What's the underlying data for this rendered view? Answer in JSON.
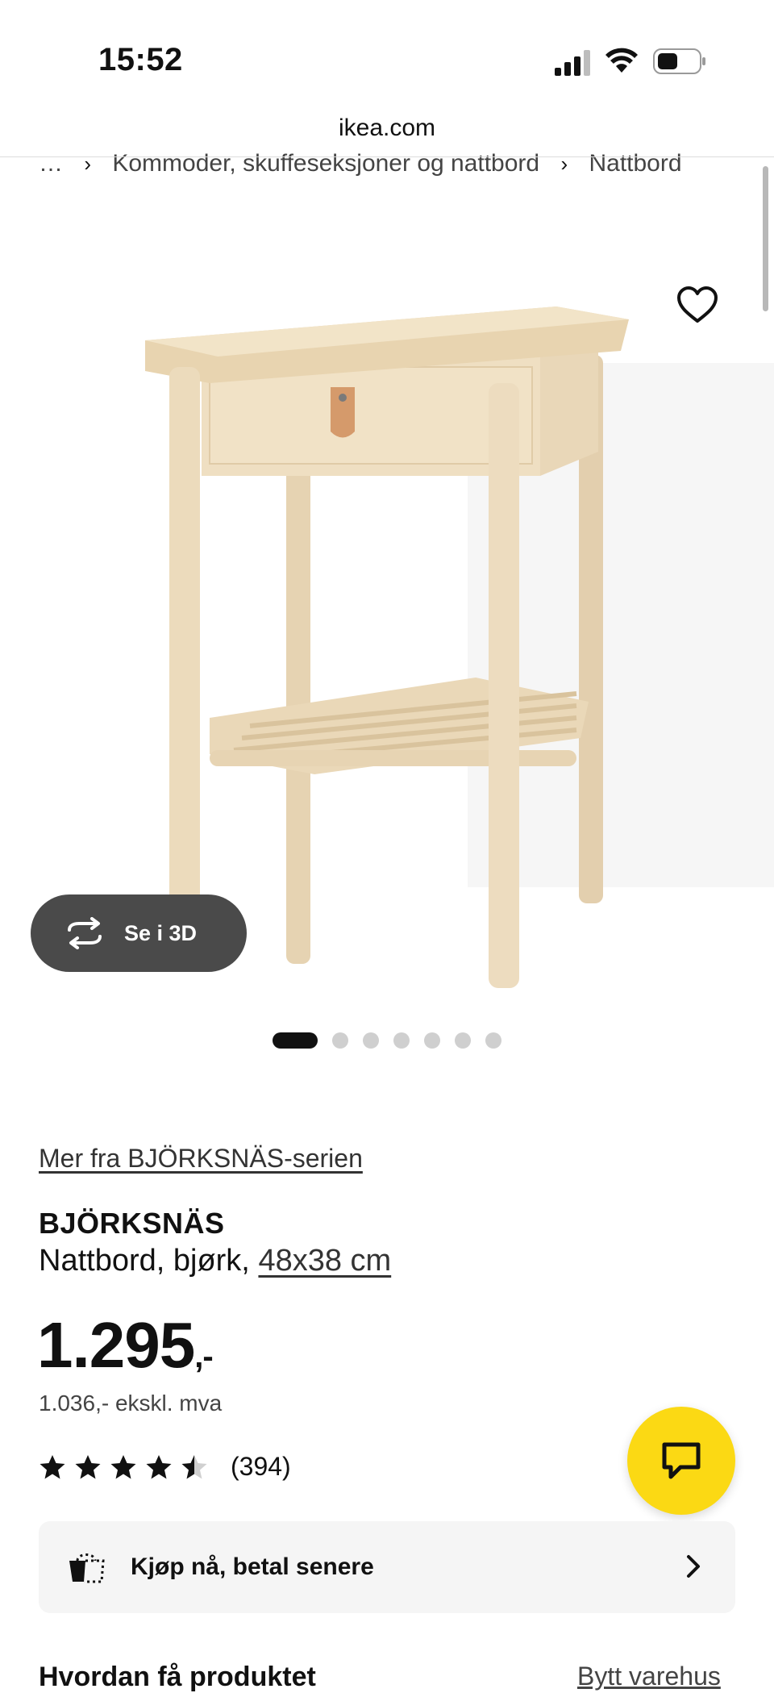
{
  "status_bar": {
    "time": "15:52"
  },
  "browser": {
    "url": "ikea.com"
  },
  "breadcrumb": {
    "items": [
      "…",
      "Kommoder, skuffeseksjoner og nattbord",
      "Nattbord"
    ]
  },
  "gallery": {
    "view_3d_label": "Se i 3D",
    "image_count": 7,
    "active_index": 0
  },
  "product": {
    "series_link": "Mer fra BJÖRKSNÄS-serien",
    "name": "BJÖRKSNÄS",
    "description": "Nattbord, bjørk,",
    "size_link": "48x38 cm",
    "price": "1.295",
    "price_suffix": ",-",
    "price_ex_vat": "1.036,- ekskl. mva",
    "rating_value": 4.5,
    "rating_count": "(394)"
  },
  "pay_later": {
    "label": "Kjøp nå, betal senere"
  },
  "delivery": {
    "title": "Hvordan få produktet",
    "change_store": "Bytt varehus"
  },
  "colors": {
    "accent_yellow": "#fbd914",
    "pill_dark": "#4a4a4a"
  }
}
